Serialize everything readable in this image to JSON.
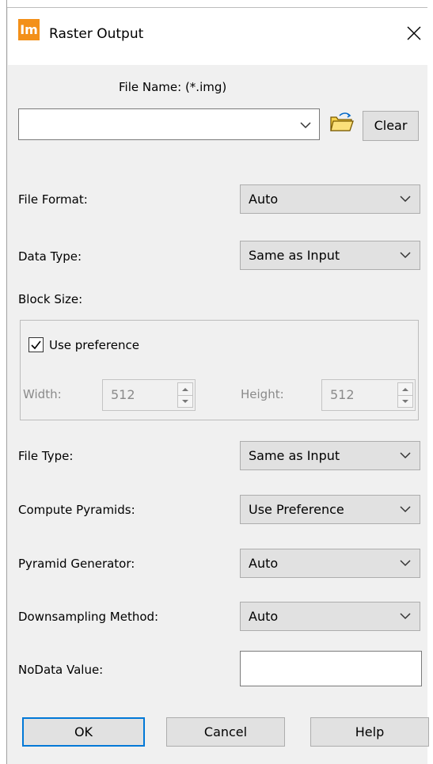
{
  "window": {
    "app_icon_text": "Im",
    "title": "Raster Output"
  },
  "file_name": {
    "label": "File Name: (*.img)",
    "value": "",
    "clear_label": "Clear"
  },
  "fields": {
    "file_format": {
      "label": "File Format:",
      "value": "Auto"
    },
    "data_type": {
      "label": "Data Type:",
      "value": "Same as Input"
    },
    "block_size": {
      "label": "Block Size:",
      "use_preference_label": "Use preference",
      "use_preference_checked": true,
      "width_label": "Width:",
      "width_value": "512",
      "height_label": "Height:",
      "height_value": "512"
    },
    "file_type": {
      "label": "File Type:",
      "value": "Same as Input"
    },
    "compute_pyramids": {
      "label": "Compute Pyramids:",
      "value": "Use Preference"
    },
    "pyramid_generator": {
      "label": "Pyramid Generator:",
      "value": "Auto"
    },
    "downsampling_method": {
      "label": "Downsampling Method:",
      "value": "Auto"
    },
    "nodata_value": {
      "label": "NoData Value:",
      "value": ""
    }
  },
  "buttons": {
    "ok": "OK",
    "cancel": "Cancel",
    "help": "Help"
  },
  "colors": {
    "app_icon_bg": "#f39019",
    "default_button_border": "#0078d7",
    "dialog_bg": "#f0f0f0"
  }
}
